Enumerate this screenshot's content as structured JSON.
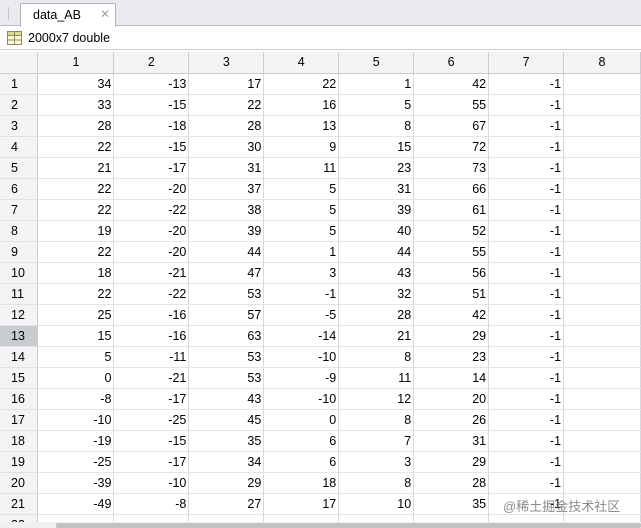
{
  "tab": {
    "title": "data_AB",
    "close_glyph": "✕"
  },
  "variable": {
    "size_label": "2000x7 double",
    "icon": "table-grid-icon"
  },
  "grid": {
    "column_headers": [
      "1",
      "2",
      "3",
      "4",
      "5",
      "6",
      "7",
      "8"
    ],
    "selected_row": "13",
    "rows": [
      {
        "label": "1",
        "cells": [
          "34",
          "-13",
          "17",
          "22",
          "1",
          "42",
          "-1",
          ""
        ]
      },
      {
        "label": "2",
        "cells": [
          "33",
          "-15",
          "22",
          "16",
          "5",
          "55",
          "-1",
          ""
        ]
      },
      {
        "label": "3",
        "cells": [
          "28",
          "-18",
          "28",
          "13",
          "8",
          "67",
          "-1",
          ""
        ]
      },
      {
        "label": "4",
        "cells": [
          "22",
          "-15",
          "30",
          "9",
          "15",
          "72",
          "-1",
          ""
        ]
      },
      {
        "label": "5",
        "cells": [
          "21",
          "-17",
          "31",
          "11",
          "23",
          "73",
          "-1",
          ""
        ]
      },
      {
        "label": "6",
        "cells": [
          "22",
          "-20",
          "37",
          "5",
          "31",
          "66",
          "-1",
          ""
        ]
      },
      {
        "label": "7",
        "cells": [
          "22",
          "-22",
          "38",
          "5",
          "39",
          "61",
          "-1",
          ""
        ]
      },
      {
        "label": "8",
        "cells": [
          "19",
          "-20",
          "39",
          "5",
          "40",
          "52",
          "-1",
          ""
        ]
      },
      {
        "label": "9",
        "cells": [
          "22",
          "-20",
          "44",
          "1",
          "44",
          "55",
          "-1",
          ""
        ]
      },
      {
        "label": "10",
        "cells": [
          "18",
          "-21",
          "47",
          "3",
          "43",
          "56",
          "-1",
          ""
        ]
      },
      {
        "label": "11",
        "cells": [
          "22",
          "-22",
          "53",
          "-1",
          "32",
          "51",
          "-1",
          ""
        ]
      },
      {
        "label": "12",
        "cells": [
          "25",
          "-16",
          "57",
          "-5",
          "28",
          "42",
          "-1",
          ""
        ]
      },
      {
        "label": "13",
        "cells": [
          "15",
          "-16",
          "63",
          "-14",
          "21",
          "29",
          "-1",
          ""
        ]
      },
      {
        "label": "14",
        "cells": [
          "5",
          "-11",
          "53",
          "-10",
          "8",
          "23",
          "-1",
          ""
        ]
      },
      {
        "label": "15",
        "cells": [
          "0",
          "-21",
          "53",
          "-9",
          "11",
          "14",
          "-1",
          ""
        ]
      },
      {
        "label": "16",
        "cells": [
          "-8",
          "-17",
          "43",
          "-10",
          "12",
          "20",
          "-1",
          ""
        ]
      },
      {
        "label": "17",
        "cells": [
          "-10",
          "-25",
          "45",
          "0",
          "8",
          "26",
          "-1",
          ""
        ]
      },
      {
        "label": "18",
        "cells": [
          "-19",
          "-15",
          "35",
          "6",
          "7",
          "31",
          "-1",
          ""
        ]
      },
      {
        "label": "19",
        "cells": [
          "-25",
          "-17",
          "34",
          "6",
          "3",
          "29",
          "-1",
          ""
        ]
      },
      {
        "label": "20",
        "cells": [
          "-39",
          "-10",
          "29",
          "18",
          "8",
          "28",
          "-1",
          ""
        ]
      },
      {
        "label": "21",
        "cells": [
          "-49",
          "-8",
          "27",
          "17",
          "10",
          "35",
          "-1",
          ""
        ]
      },
      {
        "label": "22",
        "cells": [
          "",
          "",
          "",
          "",
          "",
          "",
          "",
          ""
        ]
      }
    ]
  },
  "watermark": "@稀土掘金技术社区",
  "colors": {
    "header_bg": "#f3f4f6",
    "selected_row_bg": "#c8cbd0",
    "grid_line": "#d6d9dd"
  }
}
